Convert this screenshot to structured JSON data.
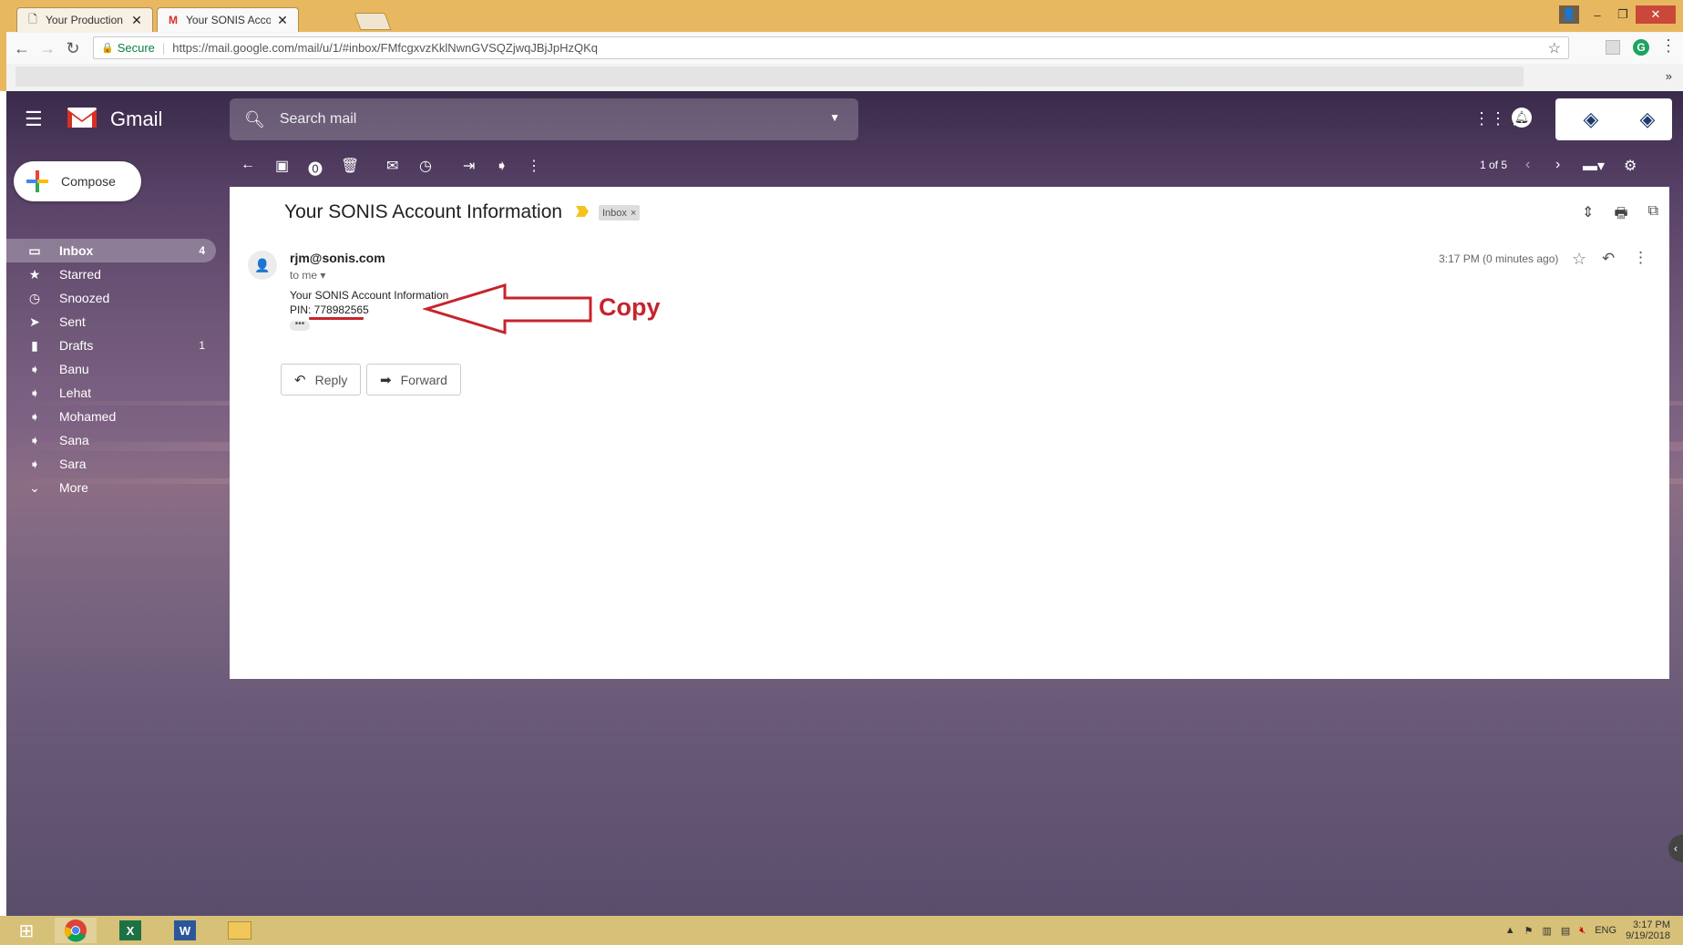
{
  "browser": {
    "tabs": [
      {
        "title": "Your Production Databas",
        "active": false
      },
      {
        "title": "Your SONIS Account Info",
        "active": true
      }
    ],
    "secure_label": "Secure",
    "url": "https://mail.google.com/mail/u/1/#inbox/FMfcgxvzKklNwnGVSQZjwqJBjJpHzQKq",
    "bookmarks_more": "»"
  },
  "gmail": {
    "brand": "Gmail",
    "search_placeholder": "Search mail",
    "compose_label": "Compose",
    "nav": [
      {
        "label": "Inbox",
        "count": "4",
        "icon": "inbox-icon",
        "active": true
      },
      {
        "label": "Starred",
        "count": "",
        "icon": "star-icon",
        "active": false
      },
      {
        "label": "Snoozed",
        "count": "",
        "icon": "clock-icon",
        "active": false
      },
      {
        "label": "Sent",
        "count": "",
        "icon": "send-icon",
        "active": false
      },
      {
        "label": "Drafts",
        "count": "1",
        "icon": "draft-icon",
        "active": false
      },
      {
        "label": "Banu",
        "count": "",
        "icon": "label-icon",
        "active": false
      },
      {
        "label": "Lehat",
        "count": "",
        "icon": "label-icon",
        "active": false
      },
      {
        "label": "Mohamed",
        "count": "",
        "icon": "label-icon",
        "active": false
      },
      {
        "label": "Sana",
        "count": "",
        "icon": "label-icon",
        "active": false
      },
      {
        "label": "Sara",
        "count": "",
        "icon": "label-icon",
        "active": false
      },
      {
        "label": "More",
        "count": "",
        "icon": "chevron-down-icon",
        "active": false
      }
    ],
    "pager": "1 of 5"
  },
  "email": {
    "subject": "Your SONIS Account Information",
    "tag": "Inbox",
    "tag_close": "×",
    "sender": "rjm@sonis.com",
    "to": "to me",
    "time": "3:17 PM (0 minutes ago)",
    "body_line1": "Your SONIS Account Information",
    "body_line2": "PIN: 778982565",
    "ellipsis": "•••",
    "reply_label": "Reply",
    "forward_label": "Forward"
  },
  "annotation": {
    "label": "Copy",
    "color": "#c6242c"
  },
  "taskbar": {
    "lang": "ENG",
    "time": "3:17 PM",
    "date": "9/19/2018"
  },
  "colors": {
    "titlebar": "#e8b860",
    "taskbar": "#d7c178",
    "close": "#c9483a"
  }
}
